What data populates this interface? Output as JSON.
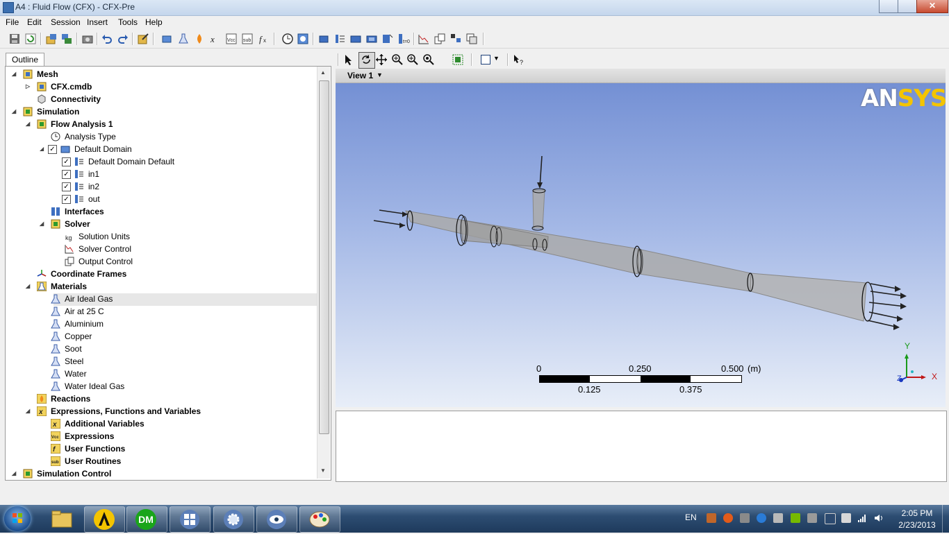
{
  "window": {
    "title": "A4 : Fluid Flow (CFX) - CFX-Pre"
  },
  "menu": [
    "File",
    "Edit",
    "Session",
    "Insert",
    "Tools",
    "Help"
  ],
  "toolbar_icons": [
    "save-icon",
    "refresh-icon",
    "import-icon",
    "export-icon",
    "camera-icon",
    "undo-icon",
    "redo-icon",
    "edit-icon",
    "domain-icon",
    "material-icon",
    "reaction-icon",
    "expression-icon",
    "vcc-icon",
    "sub-icon",
    "function-icon",
    "clock-icon",
    "solver-icon",
    "boundary-icon",
    "interface-icon",
    "subdomain-icon",
    "source-icon",
    "monitor-icon",
    "t0-icon",
    "solver-control-icon",
    "output-icon",
    "transient-icon",
    "copy-icon"
  ],
  "outline": {
    "tab_label": "Outline",
    "rows": [
      {
        "label": "Mesh",
        "bold": true
      },
      {
        "label": "CFX.cmdb",
        "bold": true
      },
      {
        "label": "Connectivity",
        "bold": true
      },
      {
        "label": "Simulation",
        "bold": true
      },
      {
        "label": "Flow Analysis 1",
        "bold": true
      },
      {
        "label": "Analysis Type",
        "bold": false
      },
      {
        "label": "Default Domain",
        "bold": false
      },
      {
        "label": "Default Domain Default",
        "bold": false
      },
      {
        "label": "in1",
        "bold": false
      },
      {
        "label": "in2",
        "bold": false
      },
      {
        "label": "out",
        "bold": false
      },
      {
        "label": "Interfaces",
        "bold": true
      },
      {
        "label": "Solver",
        "bold": true
      },
      {
        "label": "Solution Units",
        "bold": false
      },
      {
        "label": "Solver Control",
        "bold": false
      },
      {
        "label": "Output Control",
        "bold": false
      },
      {
        "label": "Coordinate Frames",
        "bold": true
      },
      {
        "label": "Materials",
        "bold": true
      },
      {
        "label": "Air Ideal Gas",
        "bold": false
      },
      {
        "label": "Air at 25 C",
        "bold": false
      },
      {
        "label": "Aluminium",
        "bold": false
      },
      {
        "label": "Copper",
        "bold": false
      },
      {
        "label": "Soot",
        "bold": false
      },
      {
        "label": "Steel",
        "bold": false
      },
      {
        "label": "Water",
        "bold": false
      },
      {
        "label": "Water Ideal Gas",
        "bold": false
      },
      {
        "label": "Reactions",
        "bold": true
      },
      {
        "label": "Expressions, Functions and Variables",
        "bold": true
      },
      {
        "label": "Additional Variables",
        "bold": true
      },
      {
        "label": "Expressions",
        "bold": true
      },
      {
        "label": "User Functions",
        "bold": true
      },
      {
        "label": "User Routines",
        "bold": true
      },
      {
        "label": "Simulation Control",
        "bold": true
      }
    ],
    "selected": "Air Ideal Gas"
  },
  "viewer": {
    "view_label": "View 1",
    "logo": "ANSYS",
    "scale": {
      "top_labels": [
        "0",
        "0.250",
        "0.500"
      ],
      "unit": "(m)",
      "bottom_labels": [
        "0.125",
        "0.375"
      ]
    },
    "axes": {
      "x": "X",
      "y": "Y",
      "z": "Z"
    }
  },
  "taskbar": {
    "language": "EN",
    "time": "2:05 PM",
    "date": "2/23/2013",
    "apps": [
      "windows-explorer",
      "ansys-workbench",
      "design-modeler",
      "cfx-launcher",
      "cfx-pre",
      "cfd-post",
      "paint"
    ],
    "dm_label": "DM"
  },
  "colors": {
    "viewer_top": "#7490d4",
    "viewer_bottom": "#e8eef8",
    "ansys_yellow": "#f4c400",
    "geometry": "#a9a9a9"
  }
}
